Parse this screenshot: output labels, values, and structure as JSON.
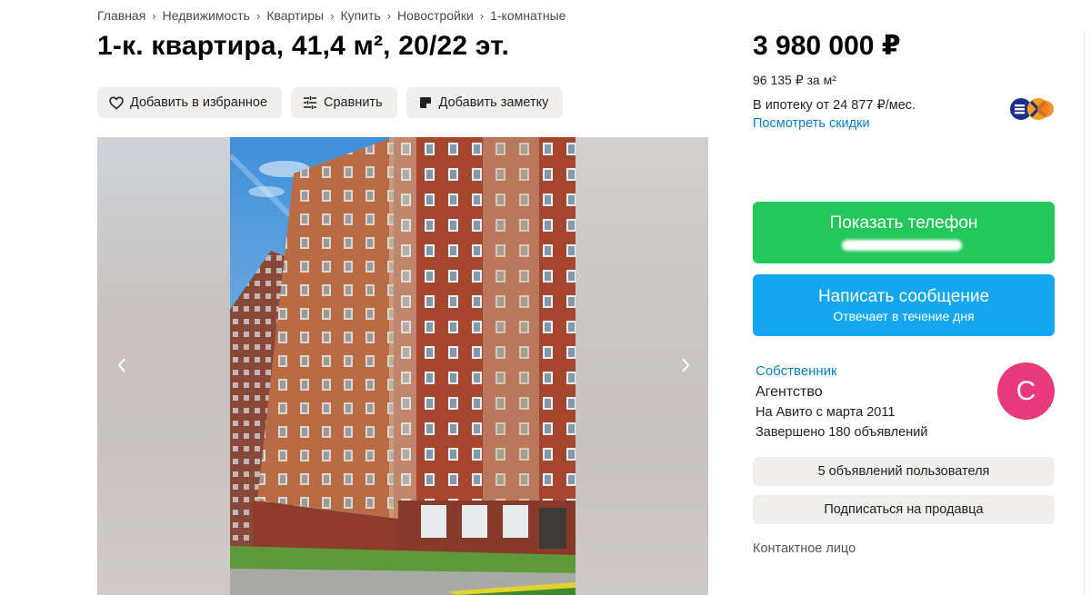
{
  "breadcrumbs": [
    "Главная",
    "Недвижимость",
    "Квартиры",
    "Купить",
    "Новостройки",
    "1-комнатные"
  ],
  "title": "1-к. квартира, 41,4 м², 20/22 эт.",
  "actions": {
    "favorite": "Добавить в избранное",
    "compare": "Сравнить",
    "note": "Добавить заметку"
  },
  "price": {
    "total": "3 980 000 ₽",
    "per_m2": "96 135 ₽ за м²",
    "mortgage": "В ипотеку от 24 877 ₽/мес.",
    "discounts_link": "Посмотреть скидки"
  },
  "contact_buttons": {
    "phone": "Показать телефон",
    "message": "Написать сообщение",
    "message_sub": "Отвечает в течение дня"
  },
  "seller": {
    "role": "Собственник",
    "name": "Агентство",
    "since": "На Авито с марта 2011",
    "completed": "Завершено 180 объявлений",
    "avatar_letter": "С",
    "avatar_color": "#e83a7a"
  },
  "seller_buttons": {
    "ads": "5 объявлений пользователя",
    "subscribe": "Подписаться на продавца"
  },
  "contact_person": "Контактное лицо",
  "colors": {
    "phone_button": "#22c95a",
    "message_button": "#14a6f1",
    "link": "#0a7ec5"
  }
}
